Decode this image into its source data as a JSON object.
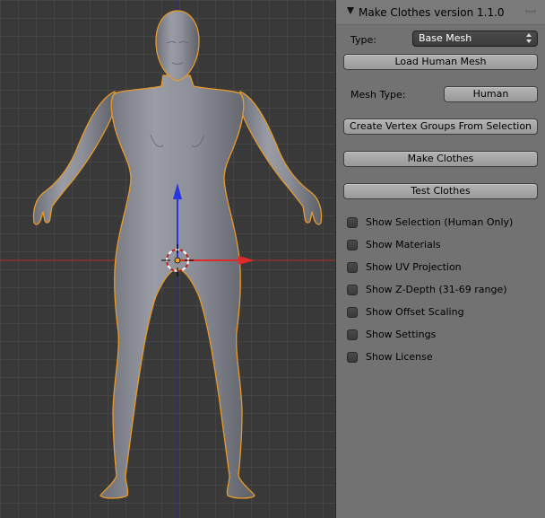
{
  "panel": {
    "title": "Make Clothes version 1.1.0",
    "type_label": "Type:",
    "type_value": "Base Mesh",
    "load_human_mesh": "Load Human Mesh",
    "mesh_type_label": "Mesh Type:",
    "mesh_type_value": "Human",
    "create_vertex_groups": "Create Vertex Groups From Selection",
    "make_clothes": "Make Clothes",
    "test_clothes": "Test Clothes",
    "checkboxes": [
      {
        "label": "Show Selection (Human Only)",
        "checked": false
      },
      {
        "label": "Show Materials",
        "checked": false
      },
      {
        "label": "Show UV Projection",
        "checked": false
      },
      {
        "label": "Show Z-Depth (31-69 range)",
        "checked": false
      },
      {
        "label": "Show Offset Scaling",
        "checked": false
      },
      {
        "label": "Show Settings",
        "checked": false
      },
      {
        "label": "Show License",
        "checked": false
      }
    ]
  },
  "viewport": {
    "object": "human-base-mesh",
    "selected": true,
    "colors": {
      "grid_background": "#393939",
      "grid_line": "#454545",
      "x_axis": "#b03030",
      "z_axis": "#2020c0",
      "mesh": "#8a8c96",
      "selection_outline": "#e89a2a"
    }
  }
}
